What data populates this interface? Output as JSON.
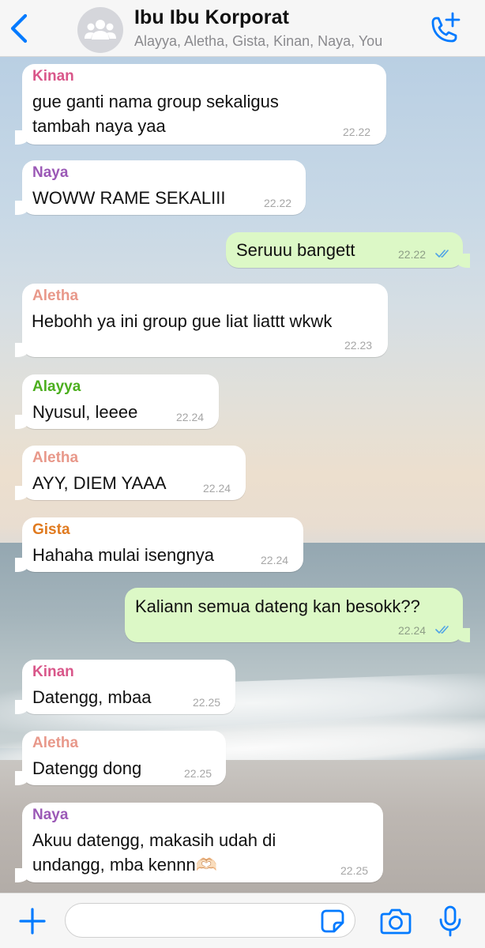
{
  "header": {
    "title": "Ibu Ibu Korporat",
    "subtitle": "Alayya, Aletha, Gista, Kinan, Naya, You",
    "back_icon": "chevron-left-icon",
    "avatar_icon": "group-icon",
    "call_icon": "add-call-icon"
  },
  "colors": {
    "accent": "#007aff",
    "outgoing_bubble": "#dcf8c6",
    "incoming_bubble": "#ffffff",
    "read_ticks": "#4fa3e6",
    "sender_kinan": "#d9578a",
    "sender_naya": "#9b59b6",
    "sender_aletha": "#e8988a",
    "sender_alayya": "#4caf1e",
    "sender_gista": "#e07a1f"
  },
  "messages": [
    {
      "sender": "Kinan",
      "text": "gue ganti nama group sekaligus\ntambah naya yaa",
      "time": "22.22"
    },
    {
      "sender": "Naya",
      "text": "WOWW RAME SEKALIII",
      "time": "22.22"
    },
    {
      "sender": "You",
      "text": "Seruuu bangett",
      "time": "22.22",
      "status": "read"
    },
    {
      "sender": "Aletha",
      "text": "Hebohh ya ini group gue liat liattt wkwk",
      "time": "22.23"
    },
    {
      "sender": "Alayya",
      "text": "Nyusul, leeee",
      "time": "22.24"
    },
    {
      "sender": "Aletha",
      "text": "AYY, DIEM YAAA",
      "time": "22.24"
    },
    {
      "sender": "Gista",
      "text": "Hahaha mulai isengnya",
      "time": "22.24"
    },
    {
      "sender": "You",
      "text": "Kaliann semua dateng kan besokk??",
      "time": "22.24",
      "status": "read"
    },
    {
      "sender": "Kinan",
      "text": "Datengg, mbaa",
      "time": "22.25"
    },
    {
      "sender": "Aletha",
      "text": "Datengg dong",
      "time": "22.25"
    },
    {
      "sender": "Naya",
      "text": "Akuu datengg, makasih udah di\nundangg, mba kennn🫶🏻",
      "time": "22.25"
    }
  ],
  "input": {
    "placeholder": "",
    "value": "",
    "plus_icon": "plus-icon",
    "sticker_icon": "sticker-icon",
    "camera_icon": "camera-icon",
    "mic_icon": "microphone-icon"
  }
}
